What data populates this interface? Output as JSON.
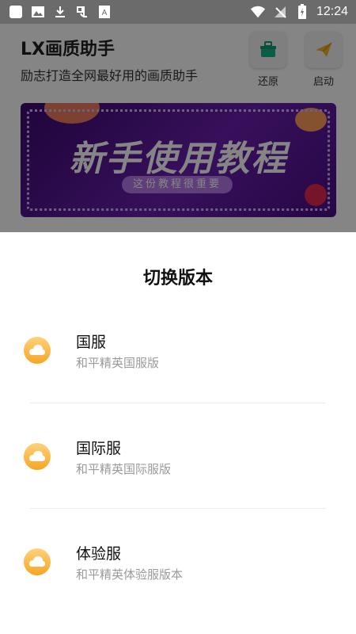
{
  "status_bar": {
    "time": "12:24",
    "left_icons": [
      "square-icon",
      "image-icon",
      "download-icon",
      "app-icon",
      "font-icon"
    ],
    "right_icons": [
      "wifi-icon",
      "no-signal-icon",
      "battery-charging-icon"
    ]
  },
  "app": {
    "title": "LX画质助手",
    "subtitle": "励志打造全网最好用的画质助手",
    "restore_label": "还原",
    "start_label": "启动",
    "banner": {
      "title": "新手使用教程",
      "subtitle": "这份教程很重要"
    }
  },
  "sheet": {
    "title": "切换版本",
    "options": [
      {
        "title": "国服",
        "subtitle": "和平精英国服版"
      },
      {
        "title": "国际服",
        "subtitle": "和平精英国际服版"
      },
      {
        "title": "体验服",
        "subtitle": "和平精英体验服版本"
      }
    ]
  },
  "colors": {
    "scrim": "#000000",
    "icon_accent": "#f6a524",
    "banner": "#6a1fb0"
  }
}
